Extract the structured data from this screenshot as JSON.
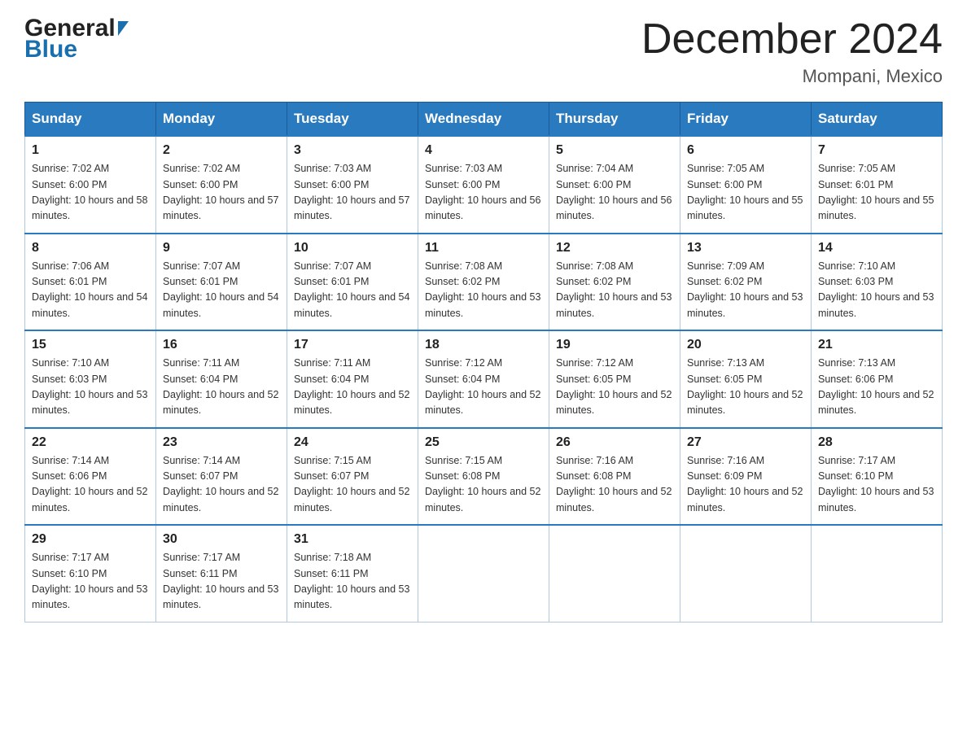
{
  "header": {
    "logo_general": "General",
    "logo_blue": "Blue",
    "month_title": "December 2024",
    "location": "Mompani, Mexico"
  },
  "days_of_week": [
    "Sunday",
    "Monday",
    "Tuesday",
    "Wednesday",
    "Thursday",
    "Friday",
    "Saturday"
  ],
  "weeks": [
    [
      {
        "day": "1",
        "sunrise": "7:02 AM",
        "sunset": "6:00 PM",
        "daylight": "10 hours and 58 minutes."
      },
      {
        "day": "2",
        "sunrise": "7:02 AM",
        "sunset": "6:00 PM",
        "daylight": "10 hours and 57 minutes."
      },
      {
        "day": "3",
        "sunrise": "7:03 AM",
        "sunset": "6:00 PM",
        "daylight": "10 hours and 57 minutes."
      },
      {
        "day": "4",
        "sunrise": "7:03 AM",
        "sunset": "6:00 PM",
        "daylight": "10 hours and 56 minutes."
      },
      {
        "day": "5",
        "sunrise": "7:04 AM",
        "sunset": "6:00 PM",
        "daylight": "10 hours and 56 minutes."
      },
      {
        "day": "6",
        "sunrise": "7:05 AM",
        "sunset": "6:00 PM",
        "daylight": "10 hours and 55 minutes."
      },
      {
        "day": "7",
        "sunrise": "7:05 AM",
        "sunset": "6:01 PM",
        "daylight": "10 hours and 55 minutes."
      }
    ],
    [
      {
        "day": "8",
        "sunrise": "7:06 AM",
        "sunset": "6:01 PM",
        "daylight": "10 hours and 54 minutes."
      },
      {
        "day": "9",
        "sunrise": "7:07 AM",
        "sunset": "6:01 PM",
        "daylight": "10 hours and 54 minutes."
      },
      {
        "day": "10",
        "sunrise": "7:07 AM",
        "sunset": "6:01 PM",
        "daylight": "10 hours and 54 minutes."
      },
      {
        "day": "11",
        "sunrise": "7:08 AM",
        "sunset": "6:02 PM",
        "daylight": "10 hours and 53 minutes."
      },
      {
        "day": "12",
        "sunrise": "7:08 AM",
        "sunset": "6:02 PM",
        "daylight": "10 hours and 53 minutes."
      },
      {
        "day": "13",
        "sunrise": "7:09 AM",
        "sunset": "6:02 PM",
        "daylight": "10 hours and 53 minutes."
      },
      {
        "day": "14",
        "sunrise": "7:10 AM",
        "sunset": "6:03 PM",
        "daylight": "10 hours and 53 minutes."
      }
    ],
    [
      {
        "day": "15",
        "sunrise": "7:10 AM",
        "sunset": "6:03 PM",
        "daylight": "10 hours and 53 minutes."
      },
      {
        "day": "16",
        "sunrise": "7:11 AM",
        "sunset": "6:04 PM",
        "daylight": "10 hours and 52 minutes."
      },
      {
        "day": "17",
        "sunrise": "7:11 AM",
        "sunset": "6:04 PM",
        "daylight": "10 hours and 52 minutes."
      },
      {
        "day": "18",
        "sunrise": "7:12 AM",
        "sunset": "6:04 PM",
        "daylight": "10 hours and 52 minutes."
      },
      {
        "day": "19",
        "sunrise": "7:12 AM",
        "sunset": "6:05 PM",
        "daylight": "10 hours and 52 minutes."
      },
      {
        "day": "20",
        "sunrise": "7:13 AM",
        "sunset": "6:05 PM",
        "daylight": "10 hours and 52 minutes."
      },
      {
        "day": "21",
        "sunrise": "7:13 AM",
        "sunset": "6:06 PM",
        "daylight": "10 hours and 52 minutes."
      }
    ],
    [
      {
        "day": "22",
        "sunrise": "7:14 AM",
        "sunset": "6:06 PM",
        "daylight": "10 hours and 52 minutes."
      },
      {
        "day": "23",
        "sunrise": "7:14 AM",
        "sunset": "6:07 PM",
        "daylight": "10 hours and 52 minutes."
      },
      {
        "day": "24",
        "sunrise": "7:15 AM",
        "sunset": "6:07 PM",
        "daylight": "10 hours and 52 minutes."
      },
      {
        "day": "25",
        "sunrise": "7:15 AM",
        "sunset": "6:08 PM",
        "daylight": "10 hours and 52 minutes."
      },
      {
        "day": "26",
        "sunrise": "7:16 AM",
        "sunset": "6:08 PM",
        "daylight": "10 hours and 52 minutes."
      },
      {
        "day": "27",
        "sunrise": "7:16 AM",
        "sunset": "6:09 PM",
        "daylight": "10 hours and 52 minutes."
      },
      {
        "day": "28",
        "sunrise": "7:17 AM",
        "sunset": "6:10 PM",
        "daylight": "10 hours and 53 minutes."
      }
    ],
    [
      {
        "day": "29",
        "sunrise": "7:17 AM",
        "sunset": "6:10 PM",
        "daylight": "10 hours and 53 minutes."
      },
      {
        "day": "30",
        "sunrise": "7:17 AM",
        "sunset": "6:11 PM",
        "daylight": "10 hours and 53 minutes."
      },
      {
        "day": "31",
        "sunrise": "7:18 AM",
        "sunset": "6:11 PM",
        "daylight": "10 hours and 53 minutes."
      },
      null,
      null,
      null,
      null
    ]
  ],
  "labels": {
    "sunrise_prefix": "Sunrise: ",
    "sunset_prefix": "Sunset: ",
    "daylight_prefix": "Daylight: "
  }
}
